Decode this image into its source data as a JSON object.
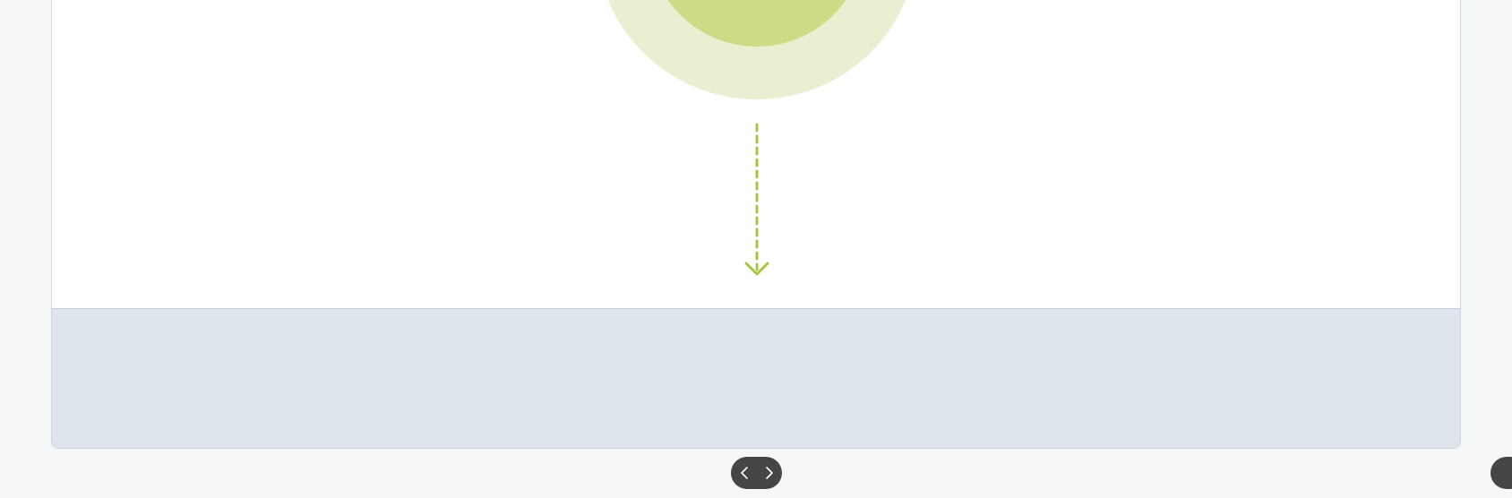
{
  "colors": {
    "background": "#f5f7f9",
    "card": "#ffffff",
    "card_border": "#cdd6e0",
    "footer": "#dfe5ed",
    "halo_outer": "#e9f0d1",
    "halo_inner": "#cbdb86",
    "arrow": "#a8c540",
    "pager": "#454545",
    "pager_icon": "#ffffff"
  },
  "icons": {
    "pager_prev": "chevron-left-icon",
    "pager_next": "chevron-right-icon",
    "flow_arrow": "dashed-arrow-down-icon"
  }
}
